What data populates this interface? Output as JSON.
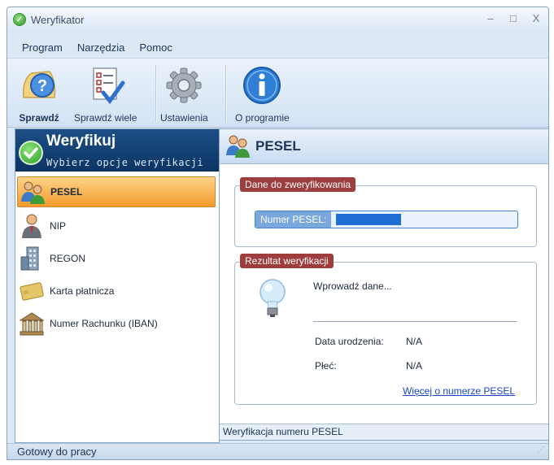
{
  "window": {
    "title": "Weryfikator",
    "controls": [
      "–",
      "□",
      "X"
    ]
  },
  "menu": {
    "items": [
      "Program",
      "Narzędzia",
      "Pomoc"
    ]
  },
  "ribbon": {
    "buttons": [
      {
        "label": "Sprawdź",
        "icon": "help-question-icon"
      },
      {
        "label": "Sprawdź wiele",
        "icon": "checklist-icon"
      },
      {
        "label": "Ustawienia",
        "icon": "gear-icon"
      },
      {
        "label": "O programie",
        "icon": "info-icon"
      }
    ]
  },
  "left_panel": {
    "title": "Weryfikuj",
    "subtitle": "Wybierz opcje weryfikacji",
    "items": [
      {
        "label": "PESEL",
        "icon": "users-icon",
        "active": true
      },
      {
        "label": "NIP",
        "icon": "businessman-icon",
        "active": false
      },
      {
        "label": "REGON",
        "icon": "building-icon",
        "active": false
      },
      {
        "label": "Karta płatnicza",
        "icon": "payment-card-icon",
        "active": false
      },
      {
        "label": "Numer Rachunku (IBAN)",
        "icon": "bank-icon",
        "active": false
      }
    ]
  },
  "right_panel": {
    "title": "PESEL",
    "input_group": {
      "label": "Dane do zweryfikowania",
      "field_label": "Numer PESEL:",
      "field_value": ""
    },
    "result_group": {
      "label": "Rezultat weryfikacji",
      "message": "Wprowadź dane...",
      "rows": [
        {
          "label": "Data urodzenia:",
          "value": "N/A"
        },
        {
          "label": "Płeć:",
          "value": "N/A"
        }
      ],
      "link": "Więcej o numerze PESEL"
    },
    "footer": "Weryfikacja numeru PESEL"
  },
  "status": {
    "text": "Gotowy do pracy"
  },
  "colors": {
    "accent_orange": "#f29a2c",
    "header_blue": "#0c3463",
    "group_label": "#9e3d3d",
    "link": "#1a45c8"
  }
}
